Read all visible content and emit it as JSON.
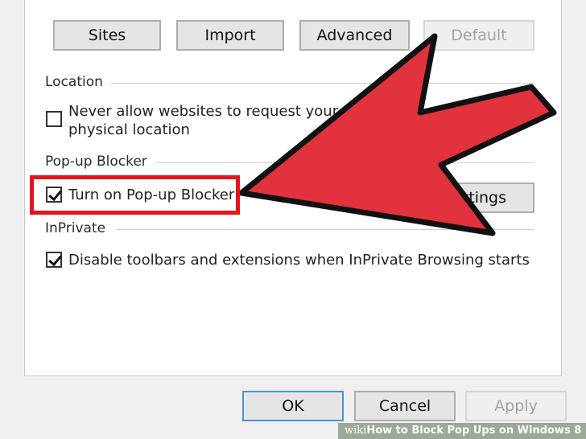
{
  "top_buttons": {
    "sites": "Sites",
    "import": "Import",
    "advanced": "Advanced",
    "default": "Default"
  },
  "location": {
    "section_title": "Location",
    "never_allow_line1": "Never allow websites to request your",
    "never_allow_line2": "physical location",
    "never_allow_checked": false
  },
  "popup_blocker": {
    "section_title": "Pop-up Blocker",
    "turn_on_label": "Turn on Pop-up Blocker",
    "turn_on_checked": true,
    "settings_button_visible_text": "ttings"
  },
  "inprivate": {
    "section_title": "InPrivate",
    "disable_toolbars_label": "Disable toolbars and extensions when InPrivate Browsing starts",
    "disable_toolbars_checked": true
  },
  "bottom_buttons": {
    "ok": "OK",
    "cancel": "Cancel",
    "apply": "Apply"
  },
  "watermark": {
    "prefix": "wiki",
    "text": "How to Block Pop Ups on Windows 8"
  },
  "annotation": {
    "arrow_color": "#e1323e",
    "highlight_color": "#e3141b"
  }
}
